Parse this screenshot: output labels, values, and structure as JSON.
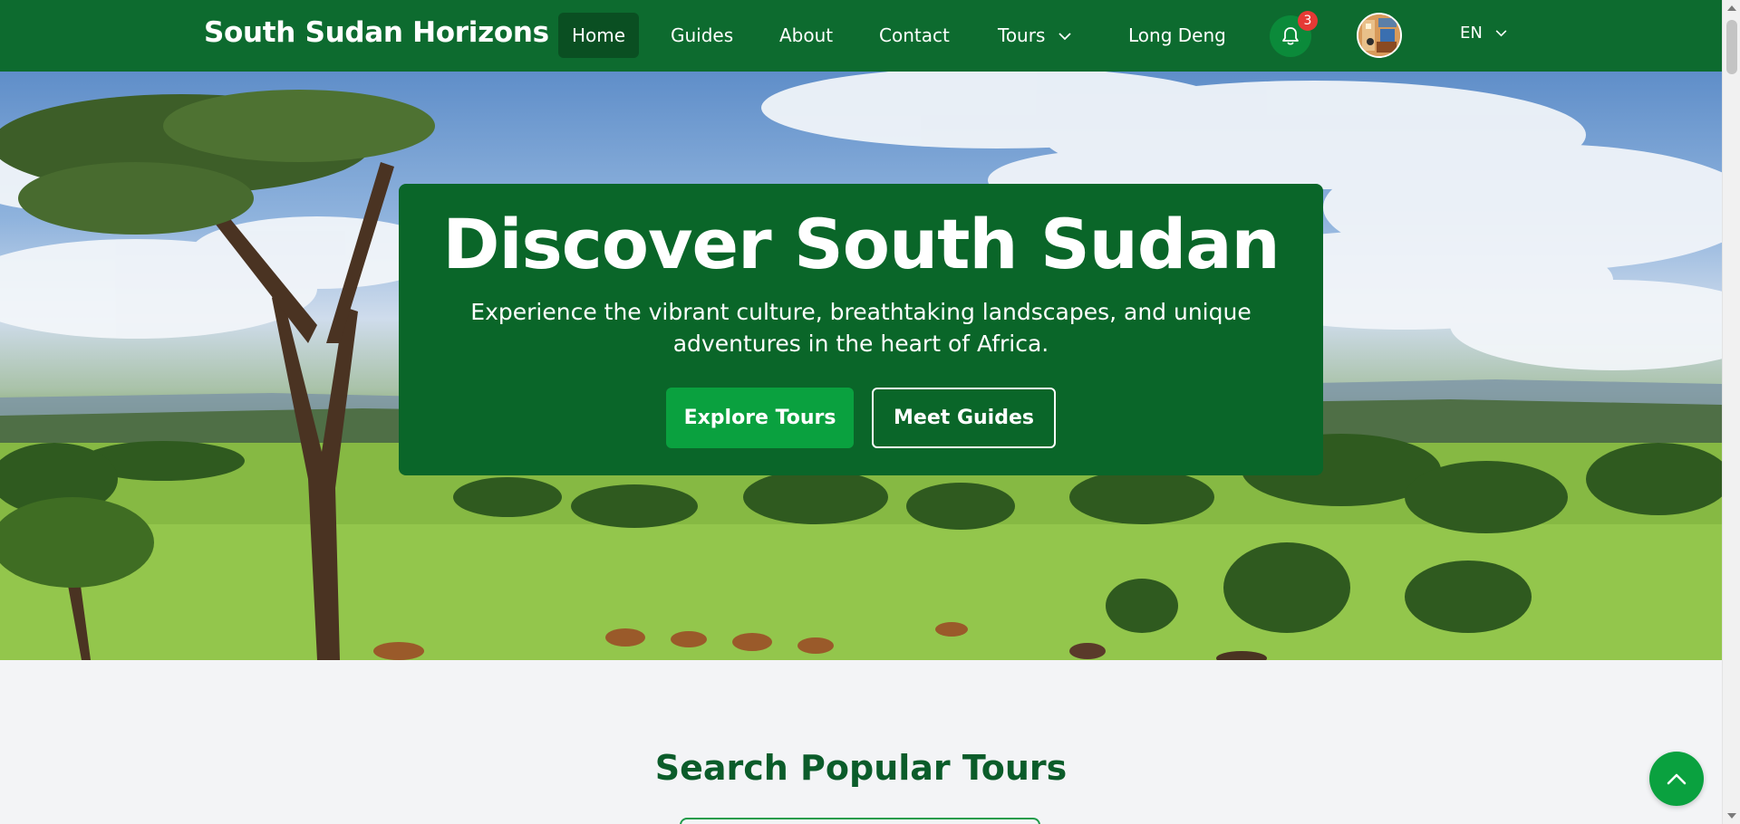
{
  "brand": {
    "name": "South Sudan Horizons"
  },
  "nav": {
    "items": [
      {
        "label": "Home",
        "active": true
      },
      {
        "label": "Guides"
      },
      {
        "label": "About"
      },
      {
        "label": "Contact"
      },
      {
        "label": "Tours",
        "has_dropdown": true
      }
    ],
    "user_name": "Long Deng",
    "notifications": {
      "icon": "bell-icon",
      "count": "3"
    },
    "avatar": {
      "icon": "user-avatar"
    },
    "language": "EN"
  },
  "hero": {
    "title": "Discover South Sudan",
    "subtitle": "Experience the vibrant culture, breathtaking landscapes, and unique adventures in the heart of Africa.",
    "primary_button": "Explore Tours",
    "secondary_button": "Meet Guides"
  },
  "search_section": {
    "title": "Search Popular Tours"
  },
  "back_to_top": {
    "icon": "chevron-up-icon"
  },
  "colors": {
    "navbar": "#0d6b2f",
    "hero_card": "#0a6629",
    "primary_button": "#0aa13f",
    "section_title": "#0b5c2a",
    "badge": "#e53935"
  }
}
